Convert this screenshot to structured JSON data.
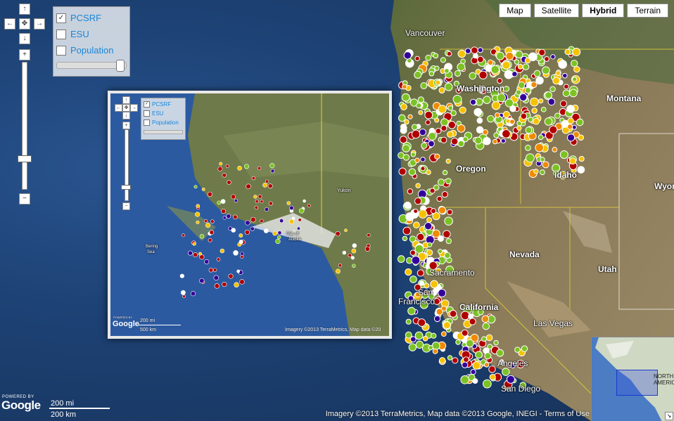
{
  "map_type_buttons": [
    "Map",
    "Satellite",
    "Hybrid",
    "Terrain"
  ],
  "active_map_type": "Hybrid",
  "layers": [
    {
      "label": "PCSRF",
      "checked": true
    },
    {
      "label": "ESU",
      "checked": false
    },
    {
      "label": "Population",
      "checked": false
    }
  ],
  "places": {
    "vancouver": "Vancouver",
    "washington": "Washington",
    "montana": "Montana",
    "idaho": "Idaho",
    "wyoming": "Wyor",
    "oregon": "Oregon",
    "nevada": "Nevada",
    "utah": "Utah",
    "sacramento": "Sacramento",
    "san_francisco_1": "San",
    "san_francisco_2": "Francisco",
    "california": "California",
    "las_vegas": "Las Vegas",
    "los_angeles": "Angeles",
    "san_diego": "San Diego",
    "north_america_1": "NORTH",
    "north_america_2": "AMERIC"
  },
  "inset_places": {
    "yukon": "Yukon",
    "bering_sea_1": "Bering",
    "bering_sea_2": "Sea",
    "gulf_1": "Gulf of",
    "gulf_2": "Alaska"
  },
  "attribution": "Imagery ©2013 TerraMetrics, Map data ©2013 Google, INEGI - Terms of Use",
  "inset_attribution": "Imagery ©2013 TerraMetrics, Map data ©20",
  "scale": {
    "mi": "200 mi",
    "km": "200 km"
  },
  "inset_scale": {
    "mi": "200 mi",
    "km": "500 km"
  },
  "logo": "Google",
  "powered_by": "POWERED BY",
  "colors": {
    "green": "#7cc225",
    "yellow": "#f5c200",
    "orange": "#f08a00",
    "red": "#b00000",
    "purple": "#330099",
    "white": "#ffffff",
    "link": "#1a86d8"
  }
}
